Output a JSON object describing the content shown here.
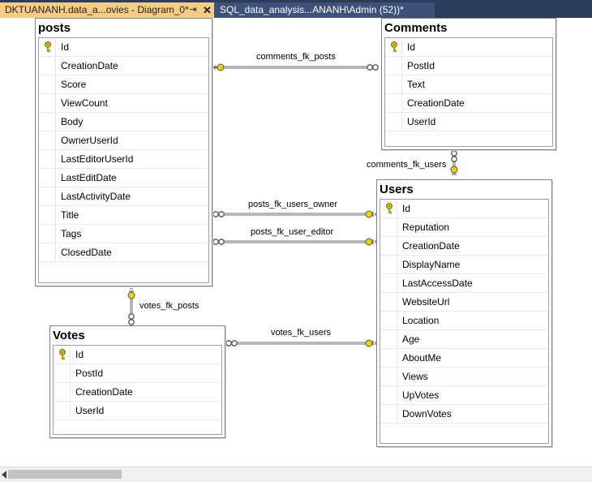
{
  "tabs": [
    {
      "label": "DKTUANANH.data_a...ovies - Diagram_0*",
      "active": true,
      "pin_icon": "pin-icon",
      "close_icon": "close-icon"
    },
    {
      "label": "SQL_data_analysis...ANANH\\Admin (52))*",
      "active": false
    }
  ],
  "tables": {
    "posts": {
      "title": "posts",
      "columns": [
        "Id",
        "CreationDate",
        "Score",
        "ViewCount",
        "Body",
        "OwnerUserId",
        "LastEditorUserId",
        "LastEditDate",
        "LastActivityDate",
        "Title",
        "Tags",
        "ClosedDate"
      ]
    },
    "comments": {
      "title": "Comments",
      "columns": [
        "Id",
        "PostId",
        "Text",
        "CreationDate",
        "UserId"
      ]
    },
    "users": {
      "title": "Users",
      "columns": [
        "Id",
        "Reputation",
        "CreationDate",
        "DisplayName",
        "LastAccessDate",
        "WebsiteUrl",
        "Location",
        "Age",
        "AboutMe",
        "Views",
        "UpVotes",
        "DownVotes"
      ]
    },
    "votes": {
      "title": "Votes",
      "columns": [
        "Id",
        "PostId",
        "CreationDate",
        "UserId"
      ]
    }
  },
  "relationships": {
    "comments_fk_posts": "comments_fk_posts",
    "comments_fk_users": "comments_fk_users",
    "posts_fk_users_owner": "posts_fk_users_owner",
    "posts_fk_user_editor": "posts_fk_user_editor",
    "votes_fk_posts": "votes_fk_posts",
    "votes_fk_users": "votes_fk_users"
  },
  "colors": {
    "tab_active": "#f5cc84",
    "tab_inactive": "#3e5279",
    "tabbar": "#2b3d5a",
    "key": "#d8b800"
  }
}
